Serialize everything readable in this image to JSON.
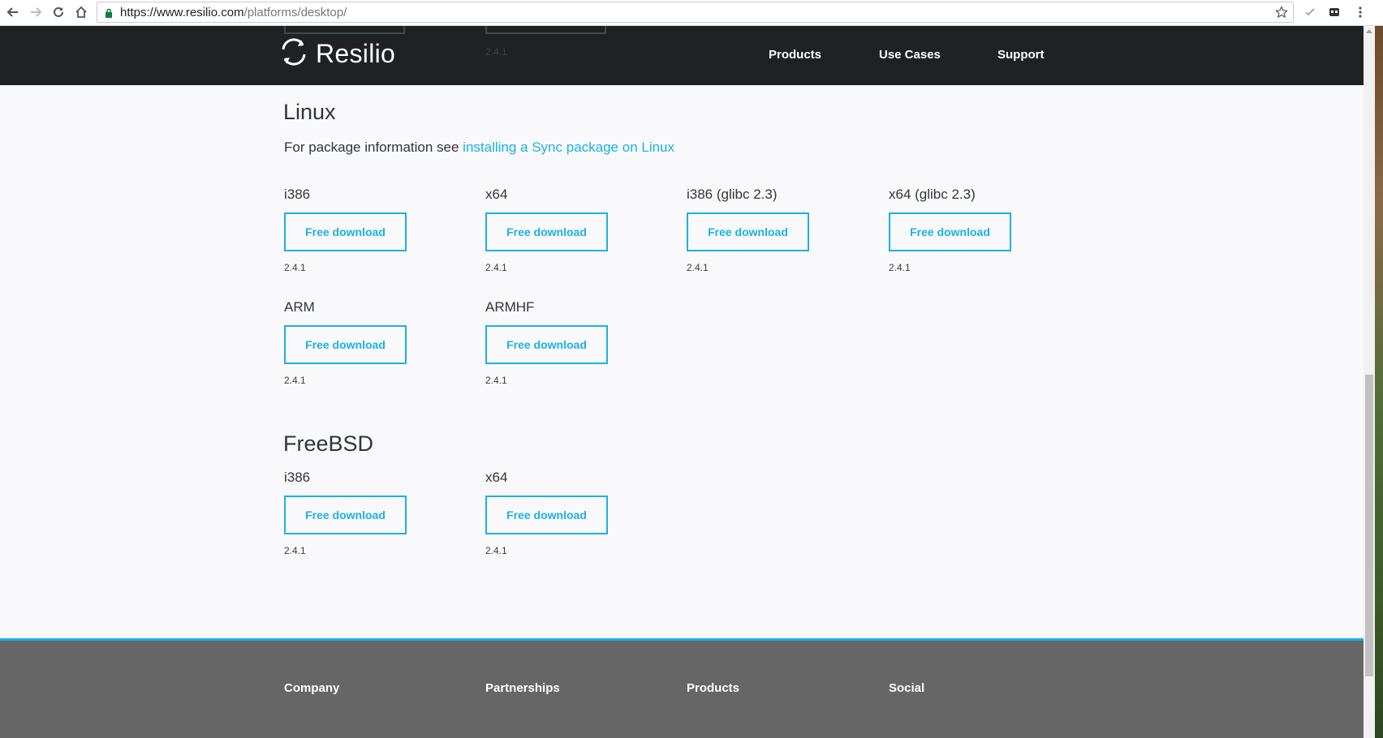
{
  "browser": {
    "url_host": "https://www.resilio.com",
    "url_path": "/platforms/desktop/"
  },
  "header": {
    "logo_text": "Resilio",
    "nav": [
      "Products",
      "Use Cases",
      "Support"
    ],
    "peek_version": "2.4.1"
  },
  "linux": {
    "title": "Linux",
    "info_prefix": "For package information see ",
    "info_link": "installing a Sync package on Linux",
    "items": [
      {
        "label": "i386",
        "button": "Free download",
        "version": "2.4.1"
      },
      {
        "label": "x64",
        "button": "Free download",
        "version": "2.4.1"
      },
      {
        "label": "i386 (glibc 2.3)",
        "button": "Free download",
        "version": "2.4.1"
      },
      {
        "label": "x64 (glibc 2.3)",
        "button": "Free download",
        "version": "2.4.1"
      },
      {
        "label": "ARM",
        "button": "Free download",
        "version": "2.4.1"
      },
      {
        "label": "ARMHF",
        "button": "Free download",
        "version": "2.4.1"
      }
    ]
  },
  "freebsd": {
    "title": "FreeBSD",
    "items": [
      {
        "label": "i386",
        "button": "Free download",
        "version": "2.4.1"
      },
      {
        "label": "x64",
        "button": "Free download",
        "version": "2.4.1"
      }
    ]
  },
  "footer": {
    "columns": [
      "Company",
      "Partnerships",
      "Products",
      "Social"
    ]
  },
  "colors": {
    "accent": "#1cb0e6",
    "header_bg": "#1e2223",
    "footer_bg": "#666666",
    "page_bg": "#f9f9fb"
  }
}
